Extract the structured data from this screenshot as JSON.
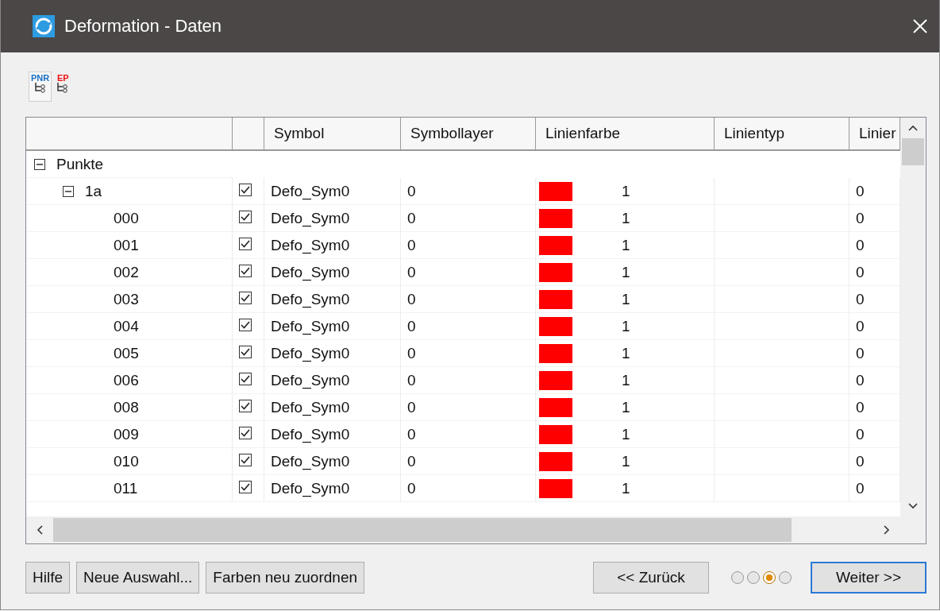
{
  "window": {
    "title": "Deformation - Daten"
  },
  "toolbar": [
    {
      "label": "PNR",
      "color": "#1a6fc4",
      "selected": true
    },
    {
      "label": "EP",
      "color": "#ee1111",
      "selected": false
    }
  ],
  "table": {
    "columns": [
      "",
      "",
      "Symbol",
      "Symbollayer",
      "Linienfarbe",
      "Linientyp",
      "Linier"
    ],
    "tree": [
      {
        "label": "Punkte",
        "expanded": true,
        "children": [
          {
            "label": "1a",
            "expanded": true,
            "checked": true,
            "symbol": "Defo_Sym0",
            "symbollayer": "0",
            "color": "#ff0000",
            "color_number": "1",
            "column_7": "0",
            "children": [
              {
                "label": "000",
                "checked": true,
                "symbol": "Defo_Sym0",
                "symbollayer": "0",
                "color": "#ff0000",
                "color_number": "1",
                "column_7": "0"
              },
              {
                "label": "001",
                "checked": true,
                "symbol": "Defo_Sym0",
                "symbollayer": "0",
                "color": "#ff0000",
                "color_number": "1",
                "column_7": "0"
              },
              {
                "label": "002",
                "checked": true,
                "symbol": "Defo_Sym0",
                "symbollayer": "0",
                "color": "#ff0000",
                "color_number": "1",
                "column_7": "0"
              },
              {
                "label": "003",
                "checked": true,
                "symbol": "Defo_Sym0",
                "symbollayer": "0",
                "color": "#ff0000",
                "color_number": "1",
                "column_7": "0"
              },
              {
                "label": "004",
                "checked": true,
                "symbol": "Defo_Sym0",
                "symbollayer": "0",
                "color": "#ff0000",
                "color_number": "1",
                "column_7": "0"
              },
              {
                "label": "005",
                "checked": true,
                "symbol": "Defo_Sym0",
                "symbollayer": "0",
                "color": "#ff0000",
                "color_number": "1",
                "column_7": "0"
              },
              {
                "label": "006",
                "checked": true,
                "symbol": "Defo_Sym0",
                "symbollayer": "0",
                "color": "#ff0000",
                "color_number": "1",
                "column_7": "0"
              },
              {
                "label": "008",
                "checked": true,
                "symbol": "Defo_Sym0",
                "symbollayer": "0",
                "color": "#ff0000",
                "color_number": "1",
                "column_7": "0"
              },
              {
                "label": "009",
                "checked": true,
                "symbol": "Defo_Sym0",
                "symbollayer": "0",
                "color": "#ff0000",
                "color_number": "1",
                "column_7": "0"
              },
              {
                "label": "010",
                "checked": true,
                "symbol": "Defo_Sym0",
                "symbollayer": "0",
                "color": "#ff0000",
                "color_number": "1",
                "column_7": "0"
              },
              {
                "label": "011",
                "checked": true,
                "symbol": "Defo_Sym0",
                "symbollayer": "0",
                "color": "#ff0000",
                "color_number": "1",
                "column_7": "0"
              }
            ]
          }
        ]
      }
    ]
  },
  "buttons_left": [
    "Hilfe",
    "Neue Auswahl...",
    "Farben neu zuordnen"
  ],
  "back_button": "<< Zurück",
  "pages": [
    {
      "selected": false
    },
    {
      "selected": false
    },
    {
      "selected": true
    },
    {
      "selected": false
    }
  ],
  "next_button": "Weiter >>"
}
